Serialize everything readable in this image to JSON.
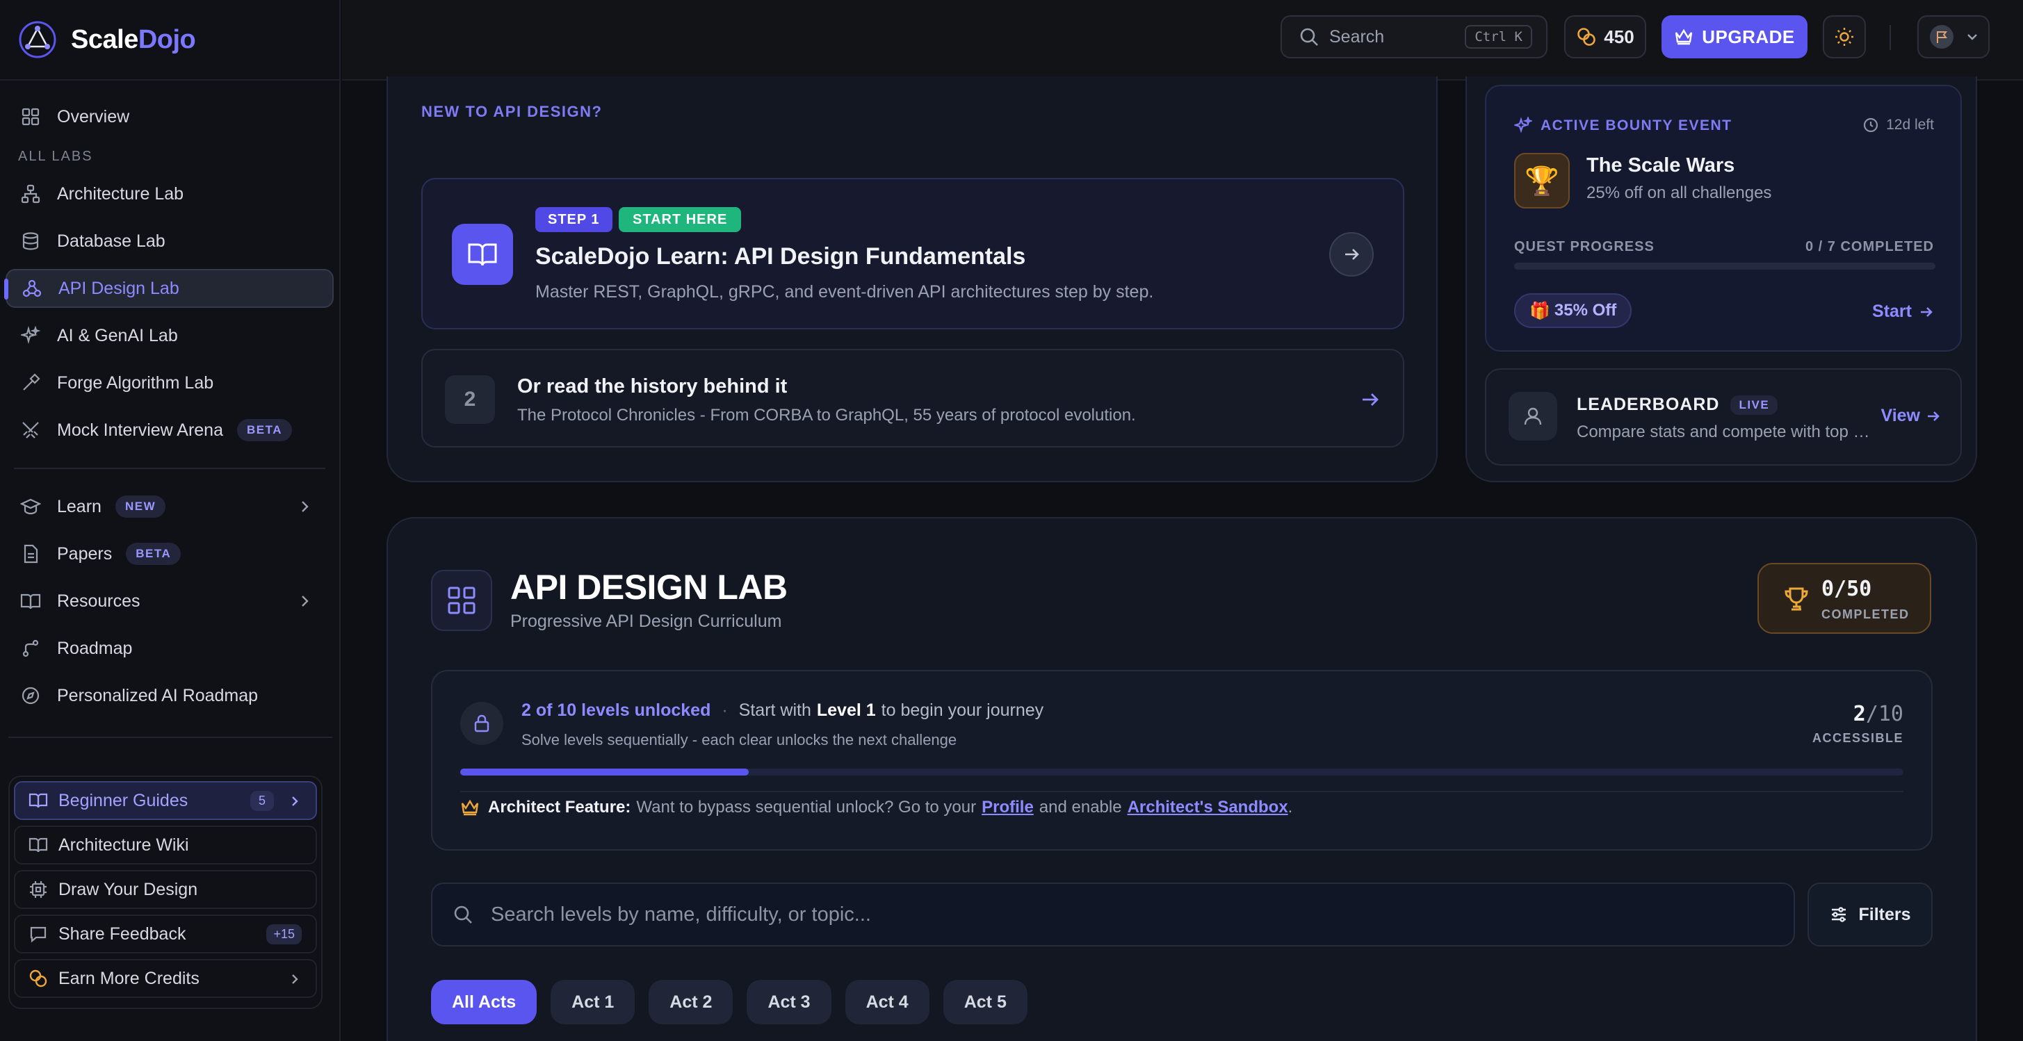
{
  "brand": {
    "name_part1": "Scale",
    "name_part2": "Dojo"
  },
  "topbar": {
    "search_label": "Search",
    "search_shortcut": "Ctrl K",
    "credits": "450",
    "upgrade_label": "UPGRADE"
  },
  "sidebar": {
    "overview": "Overview",
    "section_label": "ALL LABS",
    "labs": [
      {
        "label": "Architecture Lab"
      },
      {
        "label": "Database Lab"
      },
      {
        "label": "API Design Lab"
      },
      {
        "label": "AI & GenAI Lab"
      },
      {
        "label": "Forge Algorithm Lab"
      },
      {
        "label": "Mock Interview Arena",
        "badge": "BETA"
      }
    ],
    "secondary": [
      {
        "label": "Learn",
        "badge": "NEW"
      },
      {
        "label": "Papers",
        "badge": "BETA"
      },
      {
        "label": "Resources"
      },
      {
        "label": "Roadmap"
      },
      {
        "label": "Personalized AI Roadmap"
      }
    ],
    "tools": [
      {
        "label": "Beginner Guides",
        "count": "5"
      },
      {
        "label": "Architecture Wiki"
      },
      {
        "label": "Draw Your Design"
      },
      {
        "label": "Share Feedback",
        "count": "+15"
      },
      {
        "label": "Earn More Credits"
      }
    ]
  },
  "intro": {
    "eyebrow": "NEW TO API DESIGN?",
    "step_pill": "STEP 1",
    "start_pill": "START HERE",
    "step_title": "ScaleDojo Learn: API Design Fundamentals",
    "step_desc": "Master REST, GraphQL, gRPC, and event-driven API architectures step by step.",
    "history_num": "2",
    "history_title": "Or read the history behind it",
    "history_desc": "The Protocol Chronicles - From CORBA to GraphQL, 55 years of protocol evolution."
  },
  "bounty": {
    "eyebrow": "ACTIVE BOUNTY EVENT",
    "time_left": "12d left",
    "title": "The Scale Wars",
    "subtitle": "25% off on all challenges",
    "progress_label": "QUEST PROGRESS",
    "progress_count": "0 / 7 COMPLETED",
    "progress_fraction": 0,
    "offer": "35% Off",
    "start_label": "Start"
  },
  "leaderboard": {
    "title": "LEADERBOARD",
    "live": "LIVE",
    "desc": "Compare stats and compete with top engineers",
    "view_label": "View"
  },
  "lab": {
    "title": "API DESIGN LAB",
    "subtitle": "Progressive API Design Curriculum",
    "completed_value": "0/50",
    "completed_label": "COMPLETED",
    "unlock_accent": "2 of 10 levels unlocked",
    "unlock_pre": "Start with",
    "unlock_level": "Level 1",
    "unlock_post": "to begin your journey",
    "unlock_sub": "Solve levels sequentially - each clear unlocks the next challenge",
    "accessible_num": "2",
    "accessible_total": "/10",
    "accessible_label": "ACCESSIBLE",
    "progress_fraction": 0.2,
    "arch_label": "Architect Feature:",
    "arch_text": "Want to bypass sequential unlock? Go to your",
    "arch_link1": "Profile",
    "arch_mid": "and enable",
    "arch_link2": "Architect's Sandbox",
    "arch_end": ".",
    "search_placeholder": "Search levels by name, difficulty, or topic...",
    "filters_label": "Filters",
    "acts": [
      "All Acts",
      "Act 1",
      "Act 2",
      "Act 3",
      "Act 4",
      "Act 5"
    ]
  },
  "colors": {
    "accent": "#5b55f0",
    "accent_text": "#8d8bff",
    "success": "#1fb67d",
    "gold": "#f0a73a"
  }
}
